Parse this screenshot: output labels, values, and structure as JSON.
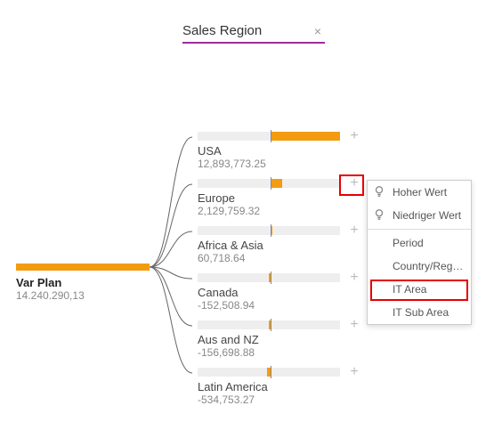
{
  "colors": {
    "accent": "#f39c12",
    "breadcrumb_underline": "#9e2b9e",
    "highlight": "#e60000"
  },
  "breadcrumb": {
    "title": "Sales Region",
    "close_glyph": "×"
  },
  "root": {
    "label": "Var Plan",
    "value": "14.240.290,13"
  },
  "children": [
    {
      "label": "USA",
      "value": "12,893,773.25",
      "plus": "+"
    },
    {
      "label": "Europe",
      "value": "2,129,759.32",
      "plus": "+"
    },
    {
      "label": "Africa & Asia",
      "value": "60,718.64",
      "plus": "+"
    },
    {
      "label": "Canada",
      "value": "-152,508.94",
      "plus": "+"
    },
    {
      "label": "Aus and NZ",
      "value": "-156,698.88",
      "plus": "+"
    },
    {
      "label": "Latin America",
      "value": "-534,753.27",
      "plus": "+"
    }
  ],
  "menu": {
    "items": [
      {
        "label": "Hoher Wert",
        "icon": "bulb"
      },
      {
        "label": "Niedriger Wert",
        "icon": "bulb"
      },
      {
        "sep": true
      },
      {
        "label": "Period"
      },
      {
        "label": "Country/Region"
      },
      {
        "label": "IT Area"
      },
      {
        "label": "IT Sub Area"
      }
    ]
  }
}
